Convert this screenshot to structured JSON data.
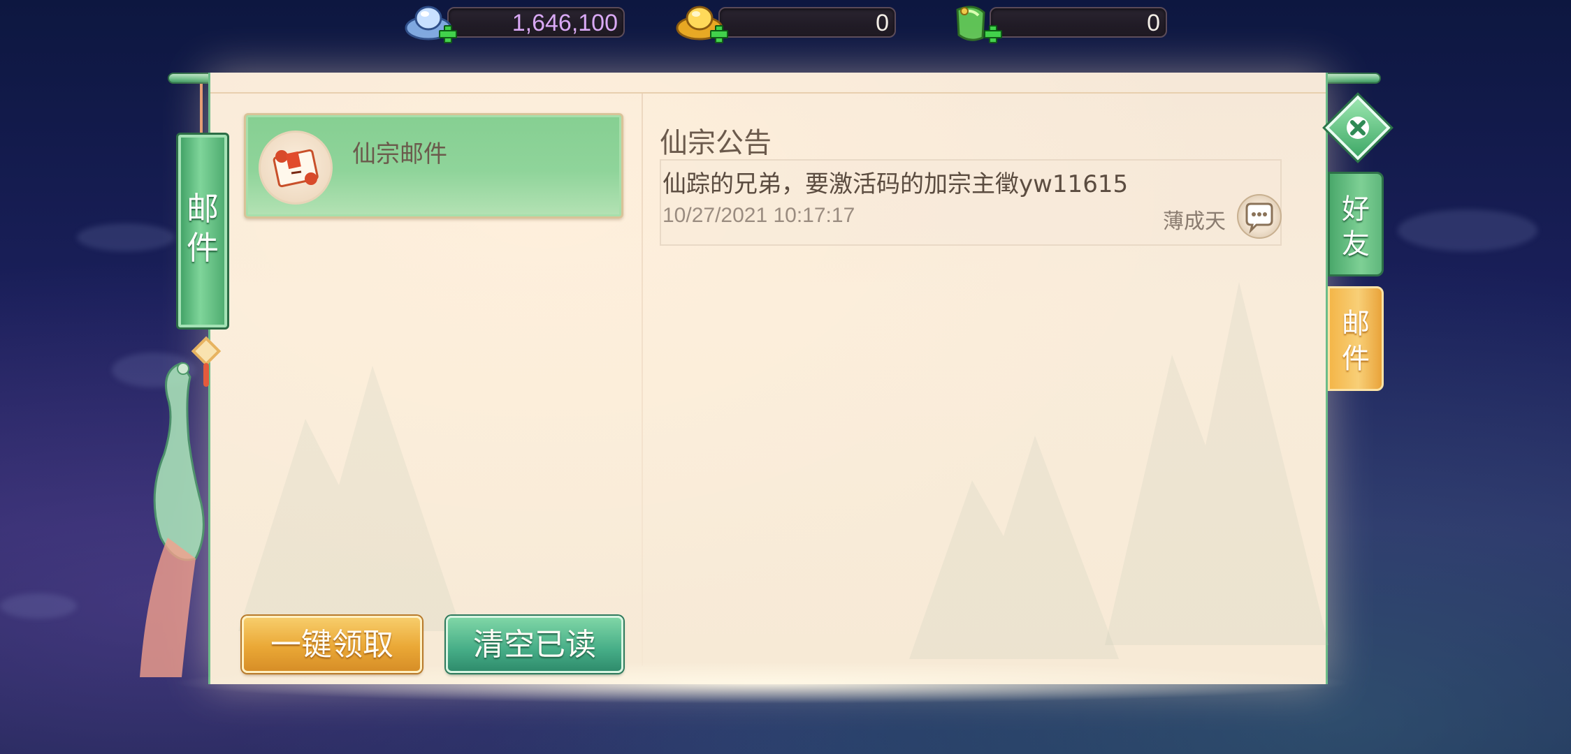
{
  "currencies": [
    {
      "name": "silver",
      "icon": "silver-ingot-icon",
      "value": "1,646,100",
      "color": "#d9a9f5"
    },
    {
      "name": "gold",
      "icon": "gold-ingot-icon",
      "value": "0",
      "color": "#f2ede6"
    },
    {
      "name": "jade",
      "icon": "jade-gem-icon",
      "value": "0",
      "color": "#f2ede6"
    }
  ],
  "left_tag": {
    "label": "邮件"
  },
  "mail_list": [
    {
      "sender": "仙宗邮件"
    }
  ],
  "buttons": {
    "claim_all": "一键领取",
    "clear_read": "清空已读"
  },
  "message": {
    "title": "仙宗公告",
    "body": "仙踪的兄弟，要激活码的加宗主徵yw11615",
    "timestamp": "10/27/2021 10:17:17",
    "author": "薄成天"
  },
  "side_tabs": {
    "friends": "好友",
    "mail": "邮件"
  },
  "colors": {
    "accent_green": "#6cbc88",
    "accent_orange": "#eaa836",
    "panel_bg": "#f7ead6"
  }
}
